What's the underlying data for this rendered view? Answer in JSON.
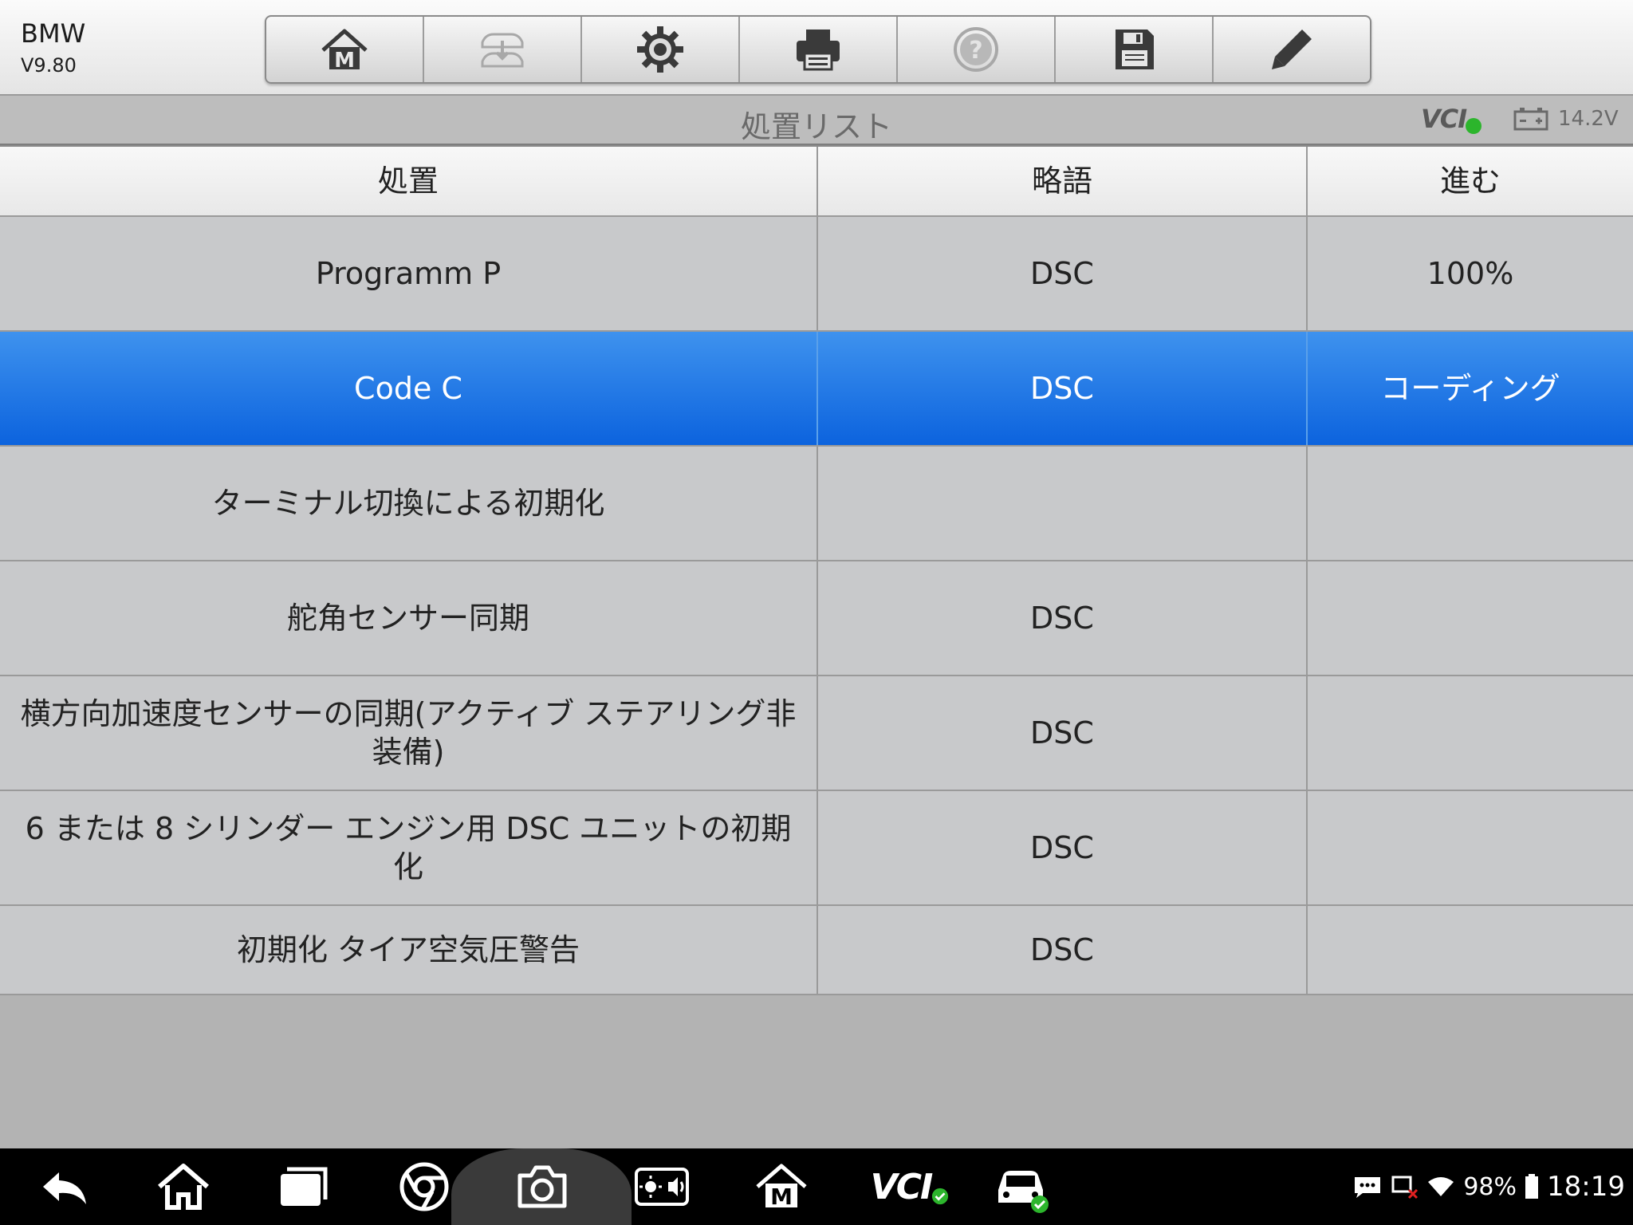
{
  "header": {
    "app_name": "BMW",
    "version": "V9.80",
    "toolbar": [
      {
        "icon": "home-m-icon"
      },
      {
        "icon": "vehicle-swap-icon",
        "disabled": true
      },
      {
        "icon": "settings-gear-icon"
      },
      {
        "icon": "printer-icon"
      },
      {
        "icon": "help-icon",
        "disabled": true
      },
      {
        "icon": "save-icon"
      },
      {
        "icon": "edit-pencil-icon"
      }
    ]
  },
  "titlebar": {
    "title": "処置リスト",
    "vci_label": "VCI",
    "voltage": "14.2V"
  },
  "table": {
    "headers": [
      "処置",
      "略語",
      "進む"
    ],
    "rows": [
      {
        "name": "Programm P",
        "abbr": "DSC",
        "progress": "100%",
        "selected": false
      },
      {
        "name": "Code C",
        "abbr": "DSC",
        "progress": "コーディング",
        "selected": true
      },
      {
        "name": "ターミナル切換による初期化",
        "abbr": "",
        "progress": "",
        "selected": false
      },
      {
        "name": "舵角センサー同期",
        "abbr": "DSC",
        "progress": "",
        "selected": false
      },
      {
        "name": "横方向加速度センサーの同期(アクティブ ステアリング非装備)",
        "abbr": "DSC",
        "progress": "",
        "selected": false
      },
      {
        "name": "6 または 8 シリンダー エンジン用 DSC ユニットの初期化",
        "abbr": "DSC",
        "progress": "",
        "selected": false
      },
      {
        "name": "初期化 タイア空気圧警告",
        "abbr": "DSC",
        "progress": "",
        "selected": false
      }
    ]
  },
  "navbar": {
    "vci_label": "VCI",
    "battery_percent": "98%",
    "time": "18:19"
  },
  "colors": {
    "selected_row": "#1a6fe3",
    "row_bg": "#c8c9cb",
    "background": "#b3b3b3",
    "status_ok": "#2cb52c"
  }
}
